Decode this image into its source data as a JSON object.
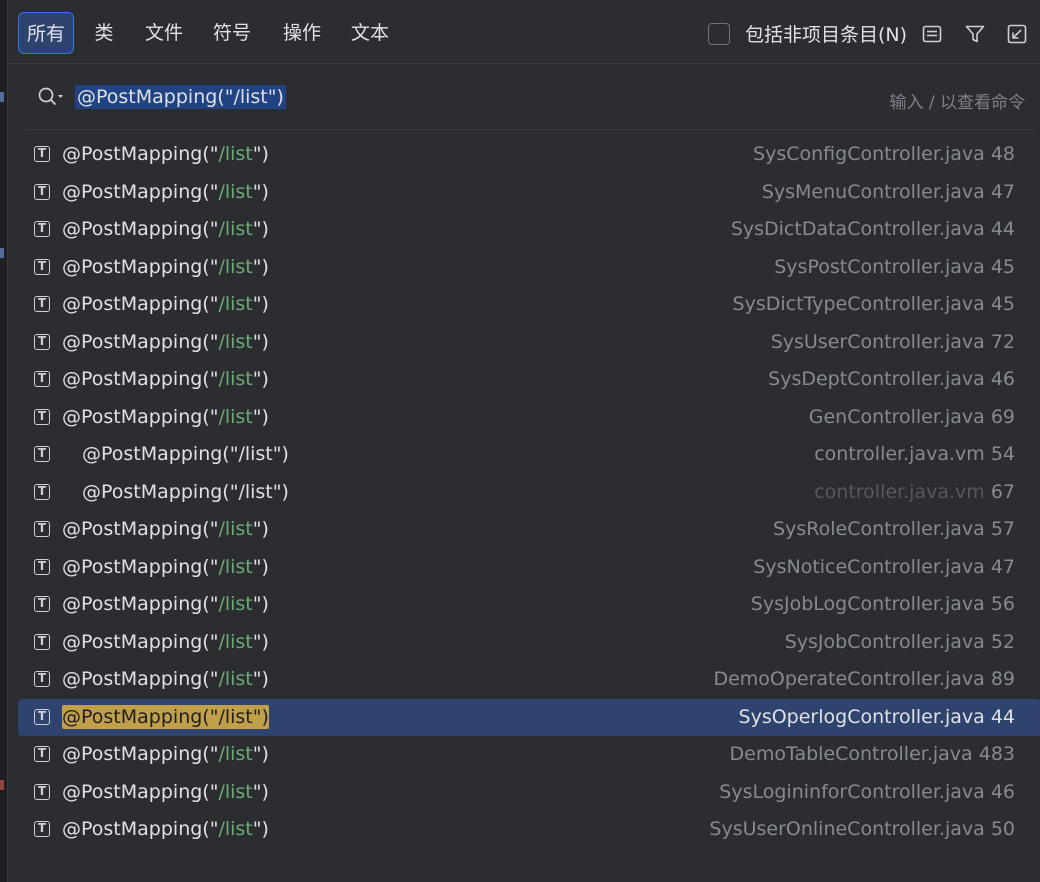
{
  "tabs": [
    {
      "label": "所有",
      "active": true
    },
    {
      "label": "类",
      "active": false
    },
    {
      "label": "文件",
      "active": false
    },
    {
      "label": "符号",
      "active": false
    },
    {
      "label": "操作",
      "active": false
    },
    {
      "label": "文本",
      "active": false
    }
  ],
  "include_non_project": {
    "label": "包括非项目条目(N)",
    "checked": false
  },
  "toolbar_icons": [
    "preview-icon",
    "filter-icon",
    "open-in-window-icon"
  ],
  "search": {
    "query": "@PostMapping(\"/list\")",
    "hint": "输入 / 以查看命令"
  },
  "results": [
    {
      "prefix": "@PostMapping(\"",
      "str": "/list",
      "suffix": "\")",
      "file": "SysConfigController.java",
      "line": "48"
    },
    {
      "prefix": "@PostMapping(\"",
      "str": "/list",
      "suffix": "\")",
      "file": "SysMenuController.java",
      "line": "47"
    },
    {
      "prefix": "@PostMapping(\"",
      "str": "/list",
      "suffix": "\")",
      "file": "SysDictDataController.java",
      "line": "44"
    },
    {
      "prefix": "@PostMapping(\"",
      "str": "/list",
      "suffix": "\")",
      "file": "SysPostController.java",
      "line": "45"
    },
    {
      "prefix": "@PostMapping(\"",
      "str": "/list",
      "suffix": "\")",
      "file": "SysDictTypeController.java",
      "line": "45"
    },
    {
      "prefix": "@PostMapping(\"",
      "str": "/list",
      "suffix": "\")",
      "file": "SysUserController.java",
      "line": "72"
    },
    {
      "prefix": "@PostMapping(\"",
      "str": "/list",
      "suffix": "\")",
      "file": "SysDeptController.java",
      "line": "46"
    },
    {
      "prefix": "@PostMapping(\"",
      "str": "/list",
      "suffix": "\")",
      "file": "GenController.java",
      "line": "69"
    },
    {
      "prefix": "@PostMapping(\"",
      "str": "/list",
      "suffix": "\")",
      "file": "controller.java.vm",
      "line": "54"
    },
    {
      "prefix": "@PostMapping(\"",
      "str": "/list",
      "suffix": "\")",
      "file": "controller.java.vm",
      "line": "67"
    },
    {
      "prefix": "@PostMapping(\"",
      "str": "/list",
      "suffix": "\")",
      "file": "SysRoleController.java",
      "line": "57"
    },
    {
      "prefix": "@PostMapping(\"",
      "str": "/list",
      "suffix": "\")",
      "file": "SysNoticeController.java",
      "line": "47"
    },
    {
      "prefix": "@PostMapping(\"",
      "str": "/list",
      "suffix": "\")",
      "file": "SysJobLogController.java",
      "line": "56"
    },
    {
      "prefix": "@PostMapping(\"",
      "str": "/list",
      "suffix": "\")",
      "file": "SysJobController.java",
      "line": "52"
    },
    {
      "prefix": "@PostMapping(\"",
      "str": "/list",
      "suffix": "\")",
      "file": "DemoOperateController.java",
      "line": "89"
    },
    {
      "prefix": "@PostMapping(\"",
      "str": "/list",
      "suffix": "\")",
      "file": "SysOperlogController.java",
      "line": "44"
    },
    {
      "prefix": "@PostMapping(\"",
      "str": "/list",
      "suffix": "\")",
      "file": "DemoTableController.java",
      "line": "483"
    },
    {
      "prefix": "@PostMapping(\"",
      "str": "/list",
      "suffix": "\")",
      "file": "SysLogininforController.java",
      "line": "46"
    },
    {
      "prefix": "@PostMapping(\"",
      "str": "/list",
      "suffix": "\")",
      "file": "SysUserOnlineController.java",
      "line": "50"
    }
  ],
  "row_icon_letter": "T",
  "colors": {
    "background": "#2b2d30",
    "selection": "#2e436e",
    "match_highlight": "#c29f49",
    "string_literal": "#6aab73",
    "active_tab_border": "#3574f0"
  }
}
